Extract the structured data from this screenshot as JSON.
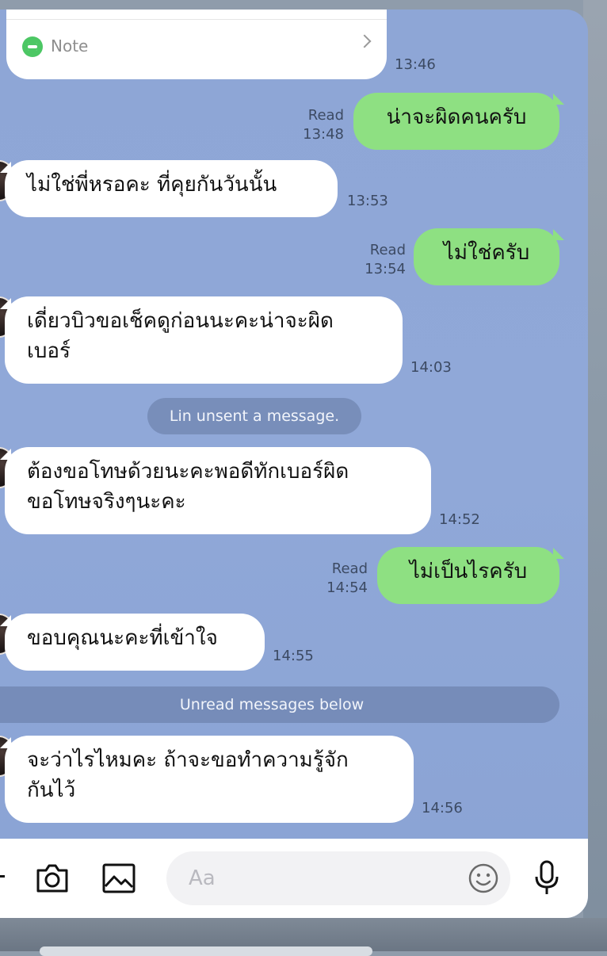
{
  "note_card": {
    "label": "Note",
    "time": "13:46"
  },
  "messages": [
    {
      "side": "out",
      "text": "น่าจะผิดคนครับ",
      "status": "Read",
      "time": "13:48"
    },
    {
      "side": "in",
      "text": "ไม่ใช่พี่หรอคะ ที่คุยกันวันนั้น",
      "time": "13:53"
    },
    {
      "side": "out",
      "text": "ไม่ใช่ครับ",
      "status": "Read",
      "time": "13:54"
    },
    {
      "side": "in",
      "line1": "เดี่ยวบิวขอเช็คดูก่อนนะคะน่าจะผิด",
      "line2": "เบอร์",
      "time": "14:03"
    },
    {
      "side": "in",
      "line1": "ต้องขอโทษด้วยนะคะพอดีทักเบอร์ผิด",
      "line2": "ขอโทษจริงๆนะคะ",
      "time": "14:52"
    },
    {
      "side": "out",
      "text": "ไม่เป็นไรครับ",
      "status": "Read",
      "time": "14:54"
    },
    {
      "side": "in",
      "text": "ขอบคุณนะคะที่เข้าใจ",
      "time": "14:55"
    },
    {
      "side": "in",
      "line1": "จะว่าไรไหมคะ ถ้าจะขอทำความรู้จัก",
      "line2": "กันไว้",
      "time": "14:56"
    }
  ],
  "system": {
    "unsent": "Lin unsent a message.",
    "unread": "Unread messages below"
  },
  "input": {
    "placeholder": "Aa"
  },
  "icons": [
    "plus-icon",
    "camera-icon",
    "image-icon",
    "emoji-icon",
    "microphone-icon"
  ],
  "colors": {
    "chat_bg": "#8ea6d6",
    "outgoing": "#8ee082",
    "incoming": "#ffffff",
    "accent_green": "#4cc764"
  }
}
